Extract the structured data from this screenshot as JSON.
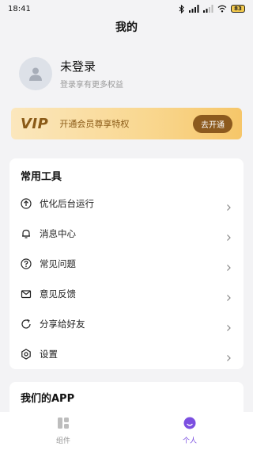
{
  "status_bar": {
    "time": "18:41",
    "battery": "83"
  },
  "page": {
    "title": "我的"
  },
  "profile": {
    "name": "未登录",
    "subtitle": "登录享有更多权益"
  },
  "vip": {
    "logo": "VIP",
    "text": "开通会员尊享特权",
    "button": "去开通"
  },
  "tools": {
    "title": "常用工具",
    "items": [
      {
        "label": "优化后台运行",
        "icon": "upload-circle-icon"
      },
      {
        "label": "消息中心",
        "icon": "bell-icon"
      },
      {
        "label": "常见问题",
        "icon": "help-circle-icon"
      },
      {
        "label": "意见反馈",
        "icon": "mail-icon"
      },
      {
        "label": "分享给好友",
        "icon": "share-refresh-icon"
      },
      {
        "label": "设置",
        "icon": "settings-hexagon-icon"
      }
    ]
  },
  "apps": {
    "title": "我们的APP"
  },
  "bottom_nav": {
    "items": [
      {
        "label": "组件",
        "icon": "widgets-icon",
        "active": false
      },
      {
        "label": "个人",
        "icon": "person-icon",
        "active": true
      }
    ]
  },
  "colors": {
    "accent": "#7b4fe0",
    "vip_brown": "#8c5a1e",
    "background": "#f3f3f5"
  }
}
